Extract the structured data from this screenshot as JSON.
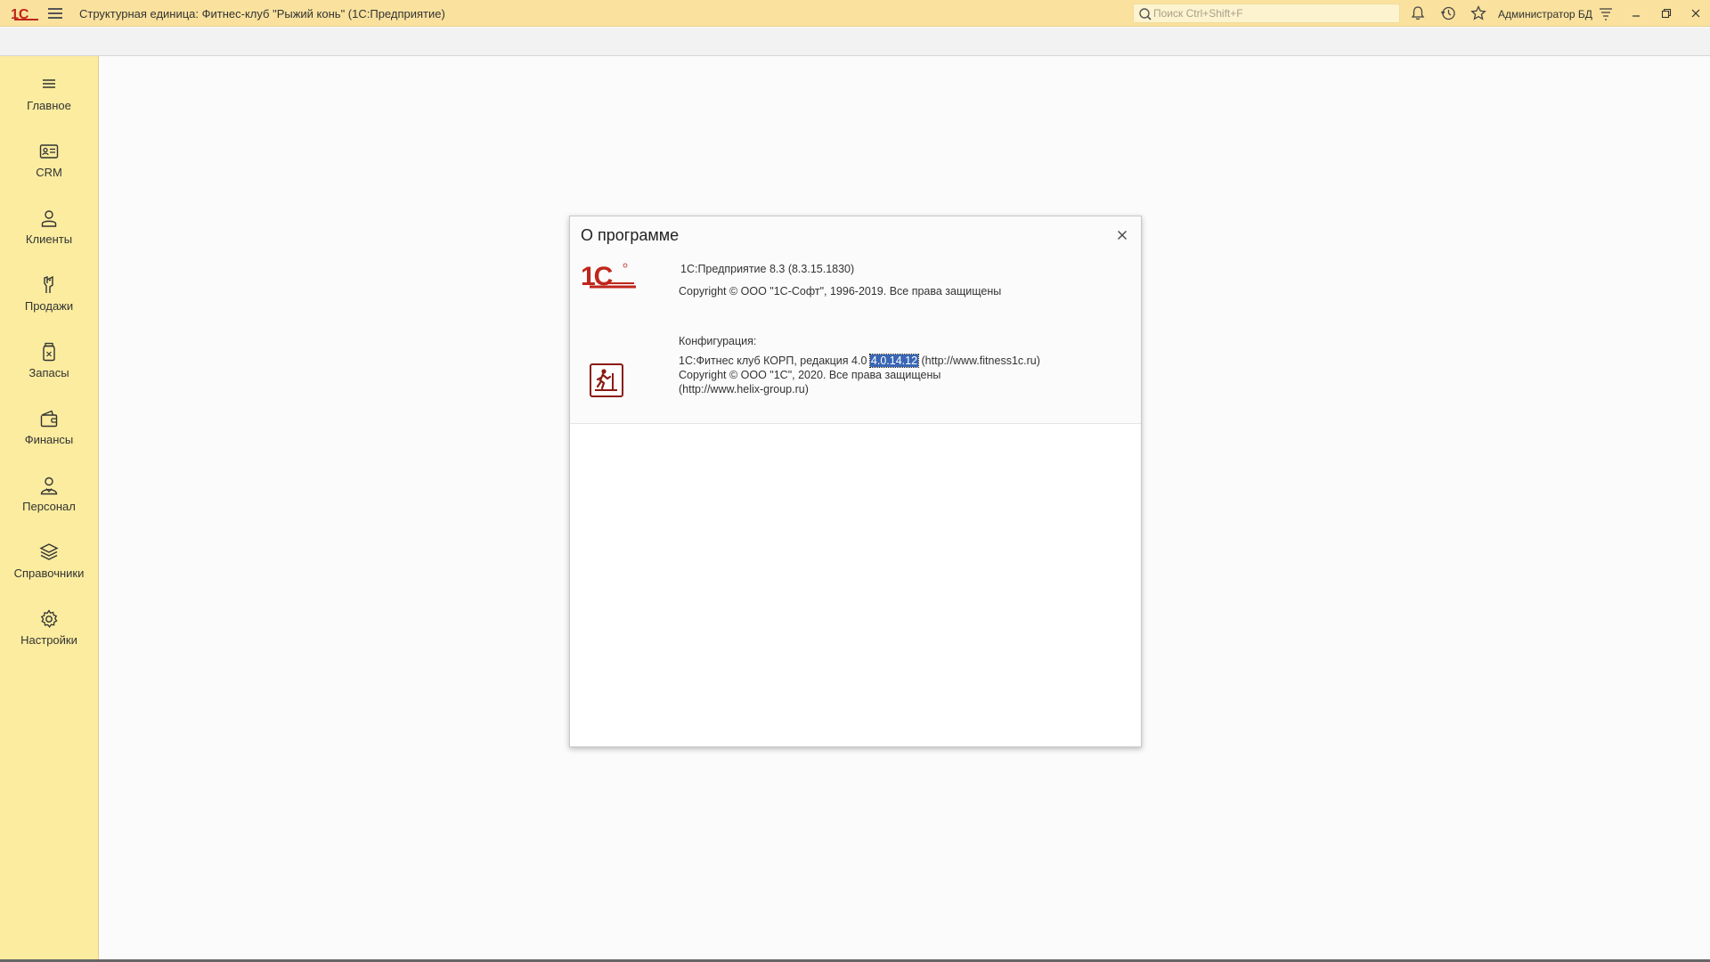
{
  "titlebar": {
    "title": "Структурная единица: Фитнес-клуб \"Рыжий конь\"  (1С:Предприятие)",
    "search_placeholder": "Поиск Ctrl+Shift+F",
    "user": "Администратор БД",
    "accent_color": "#fae29e"
  },
  "sidebar": {
    "items": [
      {
        "label": "Главное",
        "icon": "menu-lines-icon"
      },
      {
        "label": "CRM",
        "icon": "id-card-icon"
      },
      {
        "label": "Клиенты",
        "icon": "person-icon"
      },
      {
        "label": "Продажи",
        "icon": "hand-payment-icon"
      },
      {
        "label": "Запасы",
        "icon": "jar-icon"
      },
      {
        "label": "Финансы",
        "icon": "wallet-icon"
      },
      {
        "label": "Персонал",
        "icon": "staff-icon"
      },
      {
        "label": "Справочники",
        "icon": "stack-icon"
      },
      {
        "label": "Настройки",
        "icon": "gear-icon"
      }
    ],
    "color": "#fbec9f"
  },
  "dialog": {
    "title": "О программе",
    "platform": "1С:Предприятие 8.3 (8.3.15.1830)",
    "platform_copyright": "Copyright © ООО \"1С-Софт\", 1996-2019. Все права защищены",
    "config_label": "Конфигурация:",
    "config_name": "1С:Фитнес клуб КОРП, редакция 4.0",
    "config_version": "4.0.14.12",
    "config_url": "(http://www.fitness1c.ru)",
    "config_copyright": "Copyright © ООО \"1С\", 2020. Все права защищены",
    "config_vendor_url": "(http://www.helix-group.ru)"
  }
}
